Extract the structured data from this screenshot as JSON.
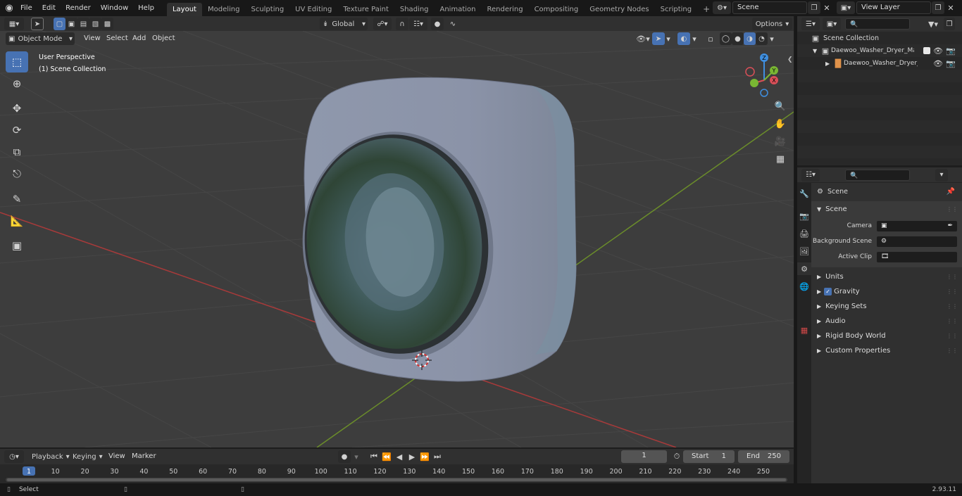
{
  "topbar": {
    "menus": [
      "File",
      "Edit",
      "Render",
      "Window",
      "Help"
    ],
    "workspaces": [
      "Layout",
      "Modeling",
      "Sculpting",
      "UV Editing",
      "Texture Paint",
      "Shading",
      "Animation",
      "Rendering",
      "Compositing",
      "Geometry Nodes",
      "Scripting"
    ],
    "active_workspace": "Layout",
    "add_tab": "+",
    "scene": "Scene",
    "view_layer": "View Layer"
  },
  "viewport_header": {
    "mode": "Object Mode",
    "menus": [
      "View",
      "Select",
      "Add",
      "Object"
    ],
    "orientation": "Global",
    "options": "Options"
  },
  "viewport": {
    "perspective": "User Perspective",
    "collection": "(1) Scene Collection",
    "gizmo": {
      "x": "X",
      "y": "Y",
      "z": "Z"
    }
  },
  "outliner": {
    "root": "Scene Collection",
    "items": [
      {
        "label": "Daewoo_Washer_Dryer_Mach"
      },
      {
        "label": "Daewoo_Washer_Dryer_I"
      }
    ]
  },
  "properties": {
    "context": "Scene",
    "panel": "Scene",
    "fields": [
      {
        "label": "Camera"
      },
      {
        "label": "Background Scene"
      },
      {
        "label": "Active Clip"
      }
    ],
    "sections": [
      "Units",
      "Gravity",
      "Keying Sets",
      "Audio",
      "Rigid Body World",
      "Custom Properties"
    ]
  },
  "timeline": {
    "menus": [
      "Playback",
      "Keying",
      "View",
      "Marker"
    ],
    "current_frame": "1",
    "start_label": "Start",
    "start": "1",
    "end_label": "End",
    "end": "250",
    "ruler": [
      "1",
      "10",
      "20",
      "30",
      "40",
      "50",
      "60",
      "70",
      "80",
      "90",
      "100",
      "110",
      "120",
      "130",
      "140",
      "150",
      "160",
      "170",
      "180",
      "190",
      "200",
      "210",
      "220",
      "230",
      "240",
      "250"
    ]
  },
  "statusbar": {
    "left": "Select",
    "version": "2.93.11"
  },
  "colors": {
    "accent": "#4772b3",
    "x_axis": "#a83a3a",
    "y_axis": "#6b8d2a",
    "gizmo_x": "#d94f58",
    "gizmo_y": "#79b733",
    "gizmo_z": "#3f8fe0"
  }
}
